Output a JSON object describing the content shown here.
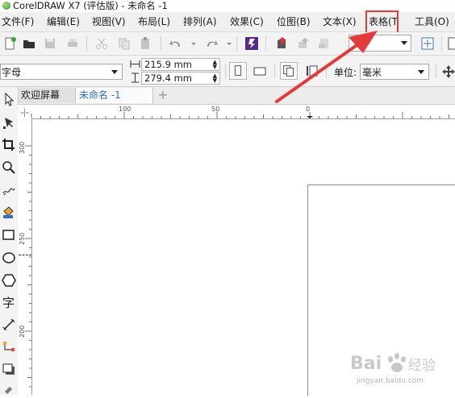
{
  "window": {
    "title": "CorelDRAW X7 (评估版) - 未命名 -1"
  },
  "menu": {
    "items": [
      {
        "label": "文件(F)"
      },
      {
        "label": "编辑(E)"
      },
      {
        "label": "视图(V)"
      },
      {
        "label": "布局(L)"
      },
      {
        "label": "排列(A)"
      },
      {
        "label": "效果(C)"
      },
      {
        "label": "位图(B)"
      },
      {
        "label": "文本(X)"
      },
      {
        "label": "表格(T"
      },
      {
        "label": "工具(O)"
      }
    ]
  },
  "toolbar": {
    "zoom_value": "%"
  },
  "property_bar": {
    "paper_type": "字母",
    "width": "215.9 mm",
    "height": "279.4 mm",
    "unit_label": "单位:",
    "unit_value": "毫米"
  },
  "tabs": {
    "welcome": "欢迎屏幕",
    "document": "未命名 -1",
    "add": "+"
  },
  "ruler": {
    "h_labels": [
      "100",
      "50",
      "0"
    ],
    "v_labels": [
      "300",
      "250",
      "200"
    ]
  },
  "watermark": {
    "brand": "Bai 经验",
    "url": "jingyan.baidu.com"
  },
  "colors": {
    "highlight": "#e23b3b",
    "arrow": "#e23b3b"
  }
}
